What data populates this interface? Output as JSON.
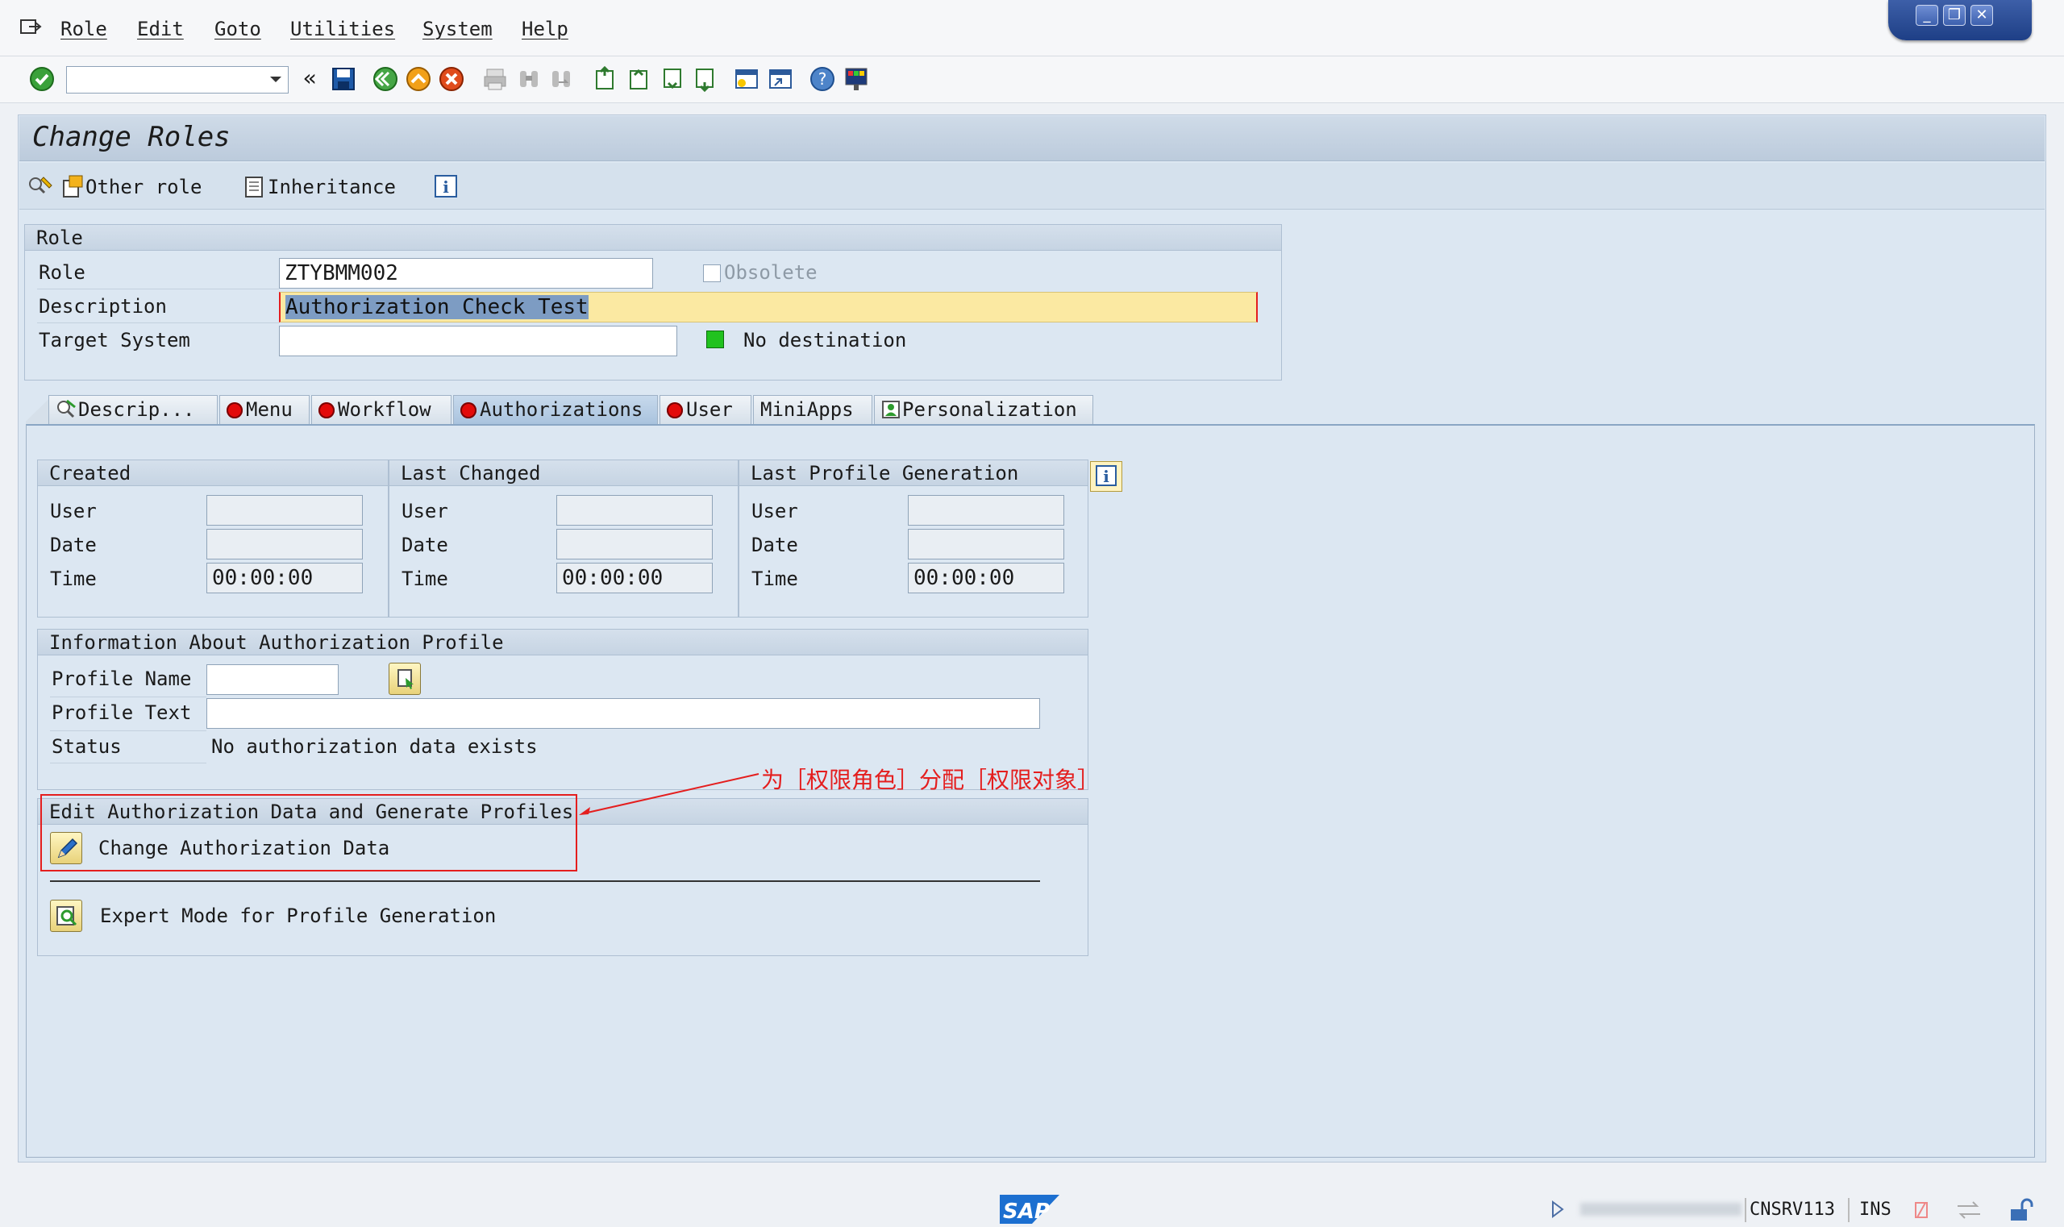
{
  "menu": [
    "Role",
    "Edit",
    "Goto",
    "Utilities",
    "System",
    "Help"
  ],
  "window_controls": {
    "minimize": "_",
    "restore": "❐",
    "close": "✕"
  },
  "toolbar": {
    "command_field": "",
    "nav_chevron": "«"
  },
  "title": "Change Roles",
  "app_toolbar": {
    "other_role": "Other role",
    "inheritance": "Inheritance"
  },
  "role_group": {
    "header": "Role",
    "role_label": "Role",
    "role_value": "ZTYBMM002",
    "obsolete_label": "Obsolete",
    "description_label": "Description",
    "description_value": "Authorization Check Test",
    "target_system_label": "Target System",
    "target_system_value": "",
    "destination_status": "No destination"
  },
  "tabs": [
    "Descrip...",
    "Menu",
    "Workflow",
    "Authorizations",
    "User",
    "MiniApps",
    "Personalization"
  ],
  "active_tab": "Authorizations",
  "created": {
    "header": "Created",
    "user_label": "User",
    "user": "",
    "date_label": "Date",
    "date": "",
    "time_label": "Time",
    "time": "00:00:00"
  },
  "last_changed": {
    "header": "Last Changed",
    "user_label": "User",
    "user": "",
    "date_label": "Date",
    "date": "",
    "time_label": "Time",
    "time": "00:00:00"
  },
  "last_profile_generation": {
    "header": "Last Profile Generation",
    "user_label": "User",
    "user": "",
    "date_label": "Date",
    "date": "",
    "time_label": "Time",
    "time": "00:00:00"
  },
  "profile_info": {
    "header": "Information About Authorization Profile",
    "name_label": "Profile Name",
    "name_value": "",
    "text_label": "Profile Text",
    "text_value": "",
    "status_label": "Status",
    "status_value": "No authorization data exists"
  },
  "edit_section": {
    "header": "Edit Authorization Data and Generate Profiles",
    "change_button": "Change Authorization Data",
    "expert_button": "Expert Mode for Profile Generation"
  },
  "annotation": "为［权限角色］分配［权限对象］",
  "status_bar": {
    "server": "CNSRV113",
    "mode": "INS",
    "logo": "SAP"
  },
  "colors": {
    "annotation": "#e41e1e",
    "status_green": "#21c21f",
    "tab_icon_red": "#e30a0a",
    "highlight_field": "#fbe9a2"
  }
}
